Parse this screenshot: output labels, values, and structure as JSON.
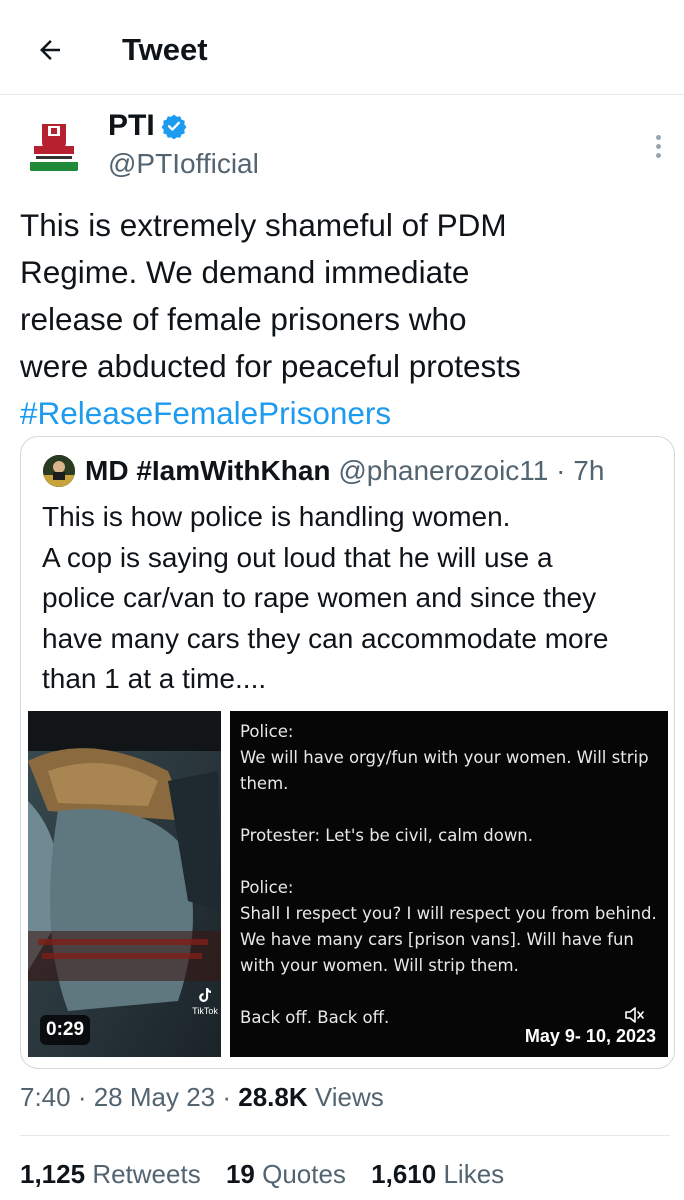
{
  "header": {
    "title": "Tweet"
  },
  "author": {
    "name": "PTI",
    "handle": "@PTIofficial",
    "verified_color": "#1d9bf0"
  },
  "tweet": {
    "text_lines": [
      "This is extremely shameful of PDM",
      "Regime. We demand immediate",
      "release of female prisoners who",
      "were abducted for peaceful protests"
    ],
    "hashtag": "#ReleaseFemalePrisoners"
  },
  "quote": {
    "name": "MD #IamWithKhan",
    "handle": "@phanerozoic11",
    "separator": " · ",
    "time": "7h",
    "text_lines": [
      "This is how police is handling women.",
      "A cop is saying out loud that he will use a",
      "police car/van to rape women and since they",
      "have many cars they can accommodate more",
      "than 1 at a time...."
    ],
    "media": {
      "video_duration": "0:29",
      "watermark": "TikTok",
      "caption_blocks": [
        "Police:\nWe will have orgy/fun with your women. Will strip\nthem.",
        "Protester: Let's be civil, calm down.",
        "Police:\nShall I respect you? I will respect you from behind.\nWe have many cars [prison vans]. Will have fun\nwith your women. Will strip them.",
        "Back off. Back off."
      ],
      "date_badge": "May 9- 10, 2023"
    }
  },
  "meta": {
    "time": "7:40",
    "separator": " · ",
    "date": "28 May 23",
    "views_count": "28.8K",
    "views_label": "Views"
  },
  "stats": {
    "retweets_count": "1,125",
    "retweets_label": "Retweets",
    "quotes_count": "19",
    "quotes_label": "Quotes",
    "likes_count": "1,610",
    "likes_label": "Likes"
  },
  "colors": {
    "link": "#1d9bf0",
    "secondary_text": "#536471",
    "primary_text": "#0f1419",
    "border": "#cfd9de"
  }
}
